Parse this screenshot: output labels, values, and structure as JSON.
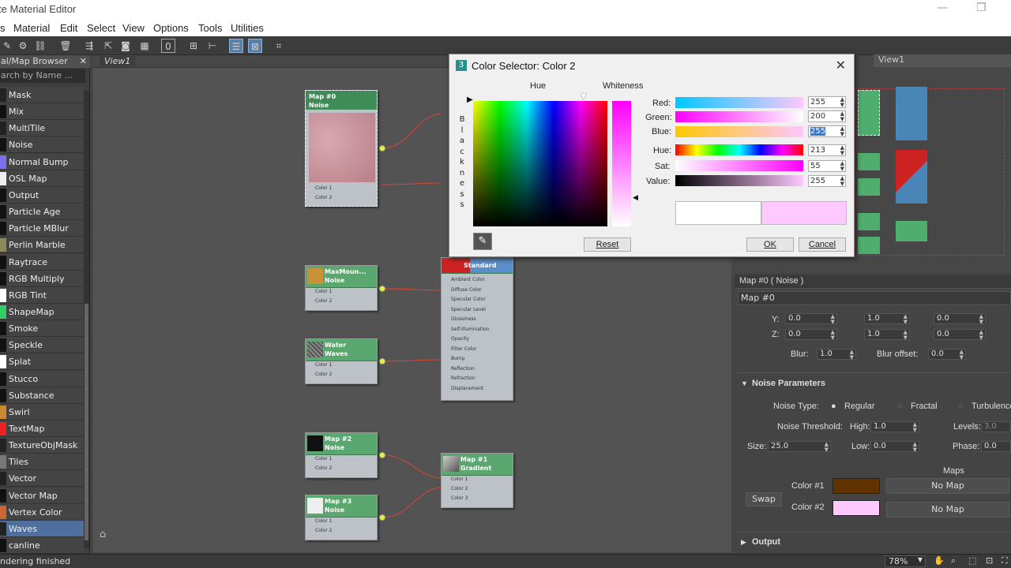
{
  "window": {
    "title": "te Material Editor"
  },
  "menu": [
    "s",
    "Material",
    "Edit",
    "Select",
    "View",
    "Options",
    "Tools",
    "Utilities"
  ],
  "browser": {
    "title": "al/Map Browser",
    "search_placeholder": "arch by Name ...",
    "items": [
      {
        "label": "Mask",
        "color": "#222"
      },
      {
        "label": "Mix",
        "color": "#111"
      },
      {
        "label": "MultiTile",
        "color": "#222"
      },
      {
        "label": "Noise",
        "color": "#111"
      },
      {
        "label": "Normal Bump",
        "color": "#7a6ff0"
      },
      {
        "label": "OSL Map",
        "color": "#eee"
      },
      {
        "label": "Output",
        "color": "#111"
      },
      {
        "label": "Particle Age",
        "color": "#111"
      },
      {
        "label": "Particle MBlur",
        "color": "#111"
      },
      {
        "label": "Perlin Marble",
        "color": "#8a8a5a"
      },
      {
        "label": "Raytrace",
        "color": "#111"
      },
      {
        "label": "RGB Multiply",
        "color": "#111"
      },
      {
        "label": "RGB Tint",
        "color": "#fff"
      },
      {
        "label": "ShapeMap",
        "color": "#3c6"
      },
      {
        "label": "Smoke",
        "color": "#111"
      },
      {
        "label": "Speckle",
        "color": "#111"
      },
      {
        "label": "Splat",
        "color": "#fff"
      },
      {
        "label": "Stucco",
        "color": "#111"
      },
      {
        "label": "Substance",
        "color": "#111"
      },
      {
        "label": "Swirl",
        "color": "#c83"
      },
      {
        "label": "TextMap",
        "color": "#e22"
      },
      {
        "label": "TextureObjMask",
        "color": "#222"
      },
      {
        "label": "Tiles",
        "color": "#777"
      },
      {
        "label": "Vector Displace...",
        "color": "#222"
      },
      {
        "label": "Vector Map",
        "color": "#111"
      },
      {
        "label": "Vertex Color",
        "color": "#c63"
      },
      {
        "label": "Waves",
        "color": "#222",
        "selected": true
      },
      {
        "label": "canline",
        "color": "#111"
      }
    ]
  },
  "view_tab": "View1",
  "nodes": {
    "map0": {
      "title": "Map #0\nNoise",
      "slots": [
        "Color 1",
        "Color 2"
      ]
    },
    "maxmount": {
      "title": "MaxMoun...\nNoise",
      "slots": [
        "Color 1",
        "Color 2"
      ]
    },
    "water": {
      "title": "Water\nWaves",
      "slots": [
        "Color 1",
        "Color 2"
      ]
    },
    "map2": {
      "title": "Map #2\nNoise",
      "slots": [
        "Color 1",
        "Color 2"
      ]
    },
    "map3": {
      "title": "Map #3\nNoise",
      "slots": [
        "Color 1",
        "Color 2"
      ]
    },
    "std": {
      "title": "Standard",
      "slots": [
        "Ambient Color",
        "Diffuse Color",
        "Specular Color",
        "Specular Level",
        "Glossiness",
        "Self-Illumination",
        "Opacity",
        "Filter Color",
        "Bump",
        "Reflection",
        "Refraction",
        "Displacement"
      ]
    },
    "map1": {
      "title": "Map #1\nGradient",
      "slots": [
        "Color 1",
        "Color 2",
        "Color 3"
      ]
    }
  },
  "dialog": {
    "title": "Color Selector: Color 2",
    "hue_label": "Hue",
    "whiteness_label": "Whiteness",
    "blackness": [
      "B",
      "l",
      "a",
      "c",
      "k",
      "n",
      "e",
      "s",
      "s"
    ],
    "red": {
      "label": "Red:",
      "value": "255"
    },
    "green": {
      "label": "Green:",
      "value": "200"
    },
    "blue": {
      "label": "Blue:",
      "value": "255"
    },
    "hue": {
      "label": "Hue:",
      "value": "213"
    },
    "sat": {
      "label": "Sat:",
      "value": "55"
    },
    "val": {
      "label": "Value:",
      "value": "255"
    },
    "reset": "Reset",
    "ok": "OK",
    "cancel": "Cancel",
    "old_color": "#ffffff",
    "new_color": "#ffc8ff"
  },
  "right_view": {
    "tab": "View1"
  },
  "props": {
    "header": "Map #0  ( Noise )",
    "name": "Map #0",
    "y_label": "Y:",
    "z_label": "Z:",
    "y": [
      "0.0",
      "1.0",
      "0.0"
    ],
    "z": [
      "0.0",
      "1.0",
      "0.0"
    ],
    "blur_label": "Blur:",
    "blur": "1.0",
    "blur_offset_label": "Blur offset:",
    "blur_offset": "0.0",
    "noise_params": "Noise Parameters",
    "noise_type_label": "Noise Type:",
    "types": [
      "Regular",
      "Fractal",
      "Turbulence"
    ],
    "threshold_label": "Noise Threshold:",
    "high_label": "High:",
    "high": "1.0",
    "levels_label": "Levels:",
    "levels": "3.0",
    "size_label": "Size:",
    "size": "25.0",
    "low_label": "Low:",
    "low": "0.0",
    "phase_label": "Phase:",
    "phase": "0.0",
    "maps_label": "Maps",
    "swap": "Swap",
    "color1_label": "Color #1",
    "color1": "#603200",
    "color2_label": "Color #2",
    "color2": "#ffc8ff",
    "nomap": "No Map",
    "output": "Output"
  },
  "status": {
    "text": "ndering finished",
    "zoom": "78%"
  }
}
